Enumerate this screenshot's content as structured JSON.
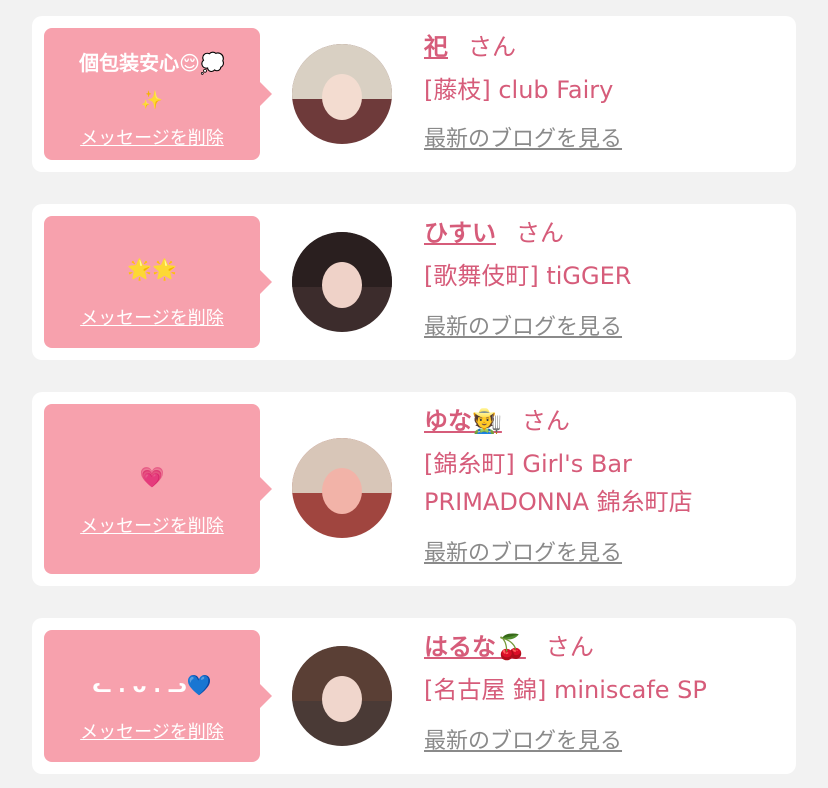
{
  "colors": {
    "page_bg": "#f2f2f2",
    "card_bg": "#ffffff",
    "bubble_bg": "#f7a1ad",
    "accent_pink": "#d65c7a",
    "link_gray": "#8a8a8a"
  },
  "delete_label": "メッセージを削除",
  "san_label": "さん",
  "blog_label": "最新のブログを見る",
  "cards": [
    {
      "message_line1": "個包装安心😌💭",
      "message_line2": "✨",
      "name": "祀",
      "shop": "[藤枝] club Fairy"
    },
    {
      "message_line1": "🌟🌟",
      "name": "ひすい",
      "shop": "[歌舞伎町] tiGGER"
    },
    {
      "message_line1": "💗",
      "name": "ゆな🧑‍🌾",
      "shop_line1": "[錦糸町] Girl's Bar",
      "shop_line2": "PRIMADONNA 錦糸町店"
    },
    {
      "message_line1": "ᓚ . ᴗ . ᓗ💙",
      "name": "はるな🍒",
      "shop": "[名古屋 錦] miniscafe SP"
    }
  ]
}
